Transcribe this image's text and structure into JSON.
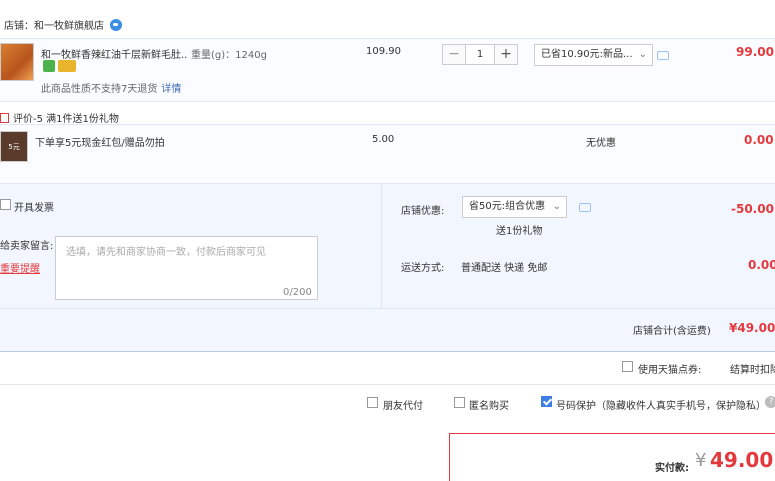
{
  "shop": {
    "label": "店铺：和一牧鲜旗舰店"
  },
  "item1": {
    "title": "和一牧鲜香辣红油千层新鲜毛肚...",
    "spec": "重量(g)：1240g",
    "note": "此商品性质不支持7天退货",
    "note_link": "详情",
    "unit_price": "109.90",
    "quantity": "1",
    "minus": "−",
    "plus": "+",
    "promo": "已省10.90元:新品...",
    "total": "99.00"
  },
  "review": {
    "text": "评价-5    满1件送1份礼物"
  },
  "item2": {
    "thumb_text": "5元",
    "title": "下单享5元现金红包/赠品勿拍",
    "unit_price": "5.00",
    "discount": "无优惠",
    "total": "0.00"
  },
  "invoice": {
    "label": "开具发票"
  },
  "message": {
    "label": "给卖家留言:",
    "warn": "重要提醒",
    "placeholder": "选填，请先和商家协商一致，付款后商家可见",
    "count": "0/200"
  },
  "shop_discount": {
    "label": "店铺优惠:",
    "selected": "省50元:组合优惠",
    "gift": "送1份礼物",
    "amount": "-50.00"
  },
  "shipping": {
    "label": "运送方式:",
    "value": "普通配送 快递 免邮",
    "amount": "0.00"
  },
  "shop_total": {
    "label": "店铺合计(含运费)",
    "amount": "¥49.00"
  },
  "points": {
    "label": "使用天猫点券:",
    "settle": "结算时扣除"
  },
  "options": {
    "friend_pay": "朋友代付",
    "anonymous": "匿名购买",
    "privacy": "号码保护（隐藏收件人真实手机号，保护隐私）"
  },
  "payment": {
    "label": "实付款:",
    "currency": "¥",
    "amount": "49.00"
  },
  "colors": {
    "accent_red": "#e4393c",
    "link_blue": "#3c6cb6",
    "panel_bg": "#f2f7ff"
  }
}
